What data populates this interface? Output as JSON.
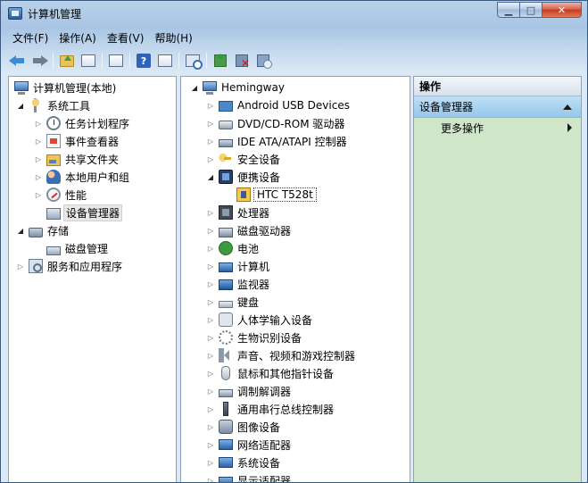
{
  "window": {
    "title": "计算机管理",
    "buttons": {
      "minimize": "▁",
      "maximize": "□",
      "close": "✕"
    }
  },
  "menu": [
    "文件(F)",
    "操作(A)",
    "查看(V)",
    "帮助(H)"
  ],
  "toolbar": [
    {
      "name": "back-button",
      "icon": "back-arrow-icon"
    },
    {
      "name": "forward-button",
      "icon": "forward-arrow-icon"
    },
    {
      "name": "up-one-level-button",
      "icon": "folder-up-icon"
    },
    {
      "name": "show-hide-console-tree-button",
      "icon": "console-tree-icon"
    },
    {
      "name": "properties-button",
      "icon": "properties-icon"
    },
    {
      "name": "help-button",
      "icon": "help-icon",
      "text": "?"
    },
    {
      "name": "show-hide-action-pane-button",
      "icon": "action-pane-icon"
    },
    {
      "name": "scan-hardware-button",
      "icon": "scan-hardware-icon"
    },
    {
      "name": "update-driver-button",
      "icon": "update-driver-icon"
    },
    {
      "name": "uninstall-button",
      "icon": "uninstall-icon"
    },
    {
      "name": "enable-device-button",
      "icon": "enable-device-icon"
    }
  ],
  "left_tree": [
    {
      "label": "计算机管理(本地)"
    },
    {
      "label": "系统工具"
    },
    {
      "label": "任务计划程序"
    },
    {
      "label": "事件查看器"
    },
    {
      "label": "共享文件夹"
    },
    {
      "label": "本地用户和组"
    },
    {
      "label": "性能"
    },
    {
      "label": "设备管理器"
    },
    {
      "label": "存储"
    },
    {
      "label": "磁盘管理"
    },
    {
      "label": "服务和应用程序"
    }
  ],
  "device_tree": {
    "root": "Hemingway",
    "items": [
      "Android USB Devices",
      "DVD/CD-ROM 驱动器",
      "IDE ATA/ATAPI 控制器",
      "安全设备",
      "便携设备",
      "HTC T528t",
      "处理器",
      "磁盘驱动器",
      "电池",
      "计算机",
      "监视器",
      "键盘",
      "人体学输入设备",
      "生物识别设备",
      "声音、视频和游戏控制器",
      "鼠标和其他指针设备",
      "调制解调器",
      "通用串行总线控制器",
      "图像设备",
      "网络适配器",
      "系统设备",
      "显示适配器"
    ]
  },
  "actions": {
    "header": "操作",
    "section": "设备管理器",
    "items": [
      "更多操作"
    ]
  }
}
